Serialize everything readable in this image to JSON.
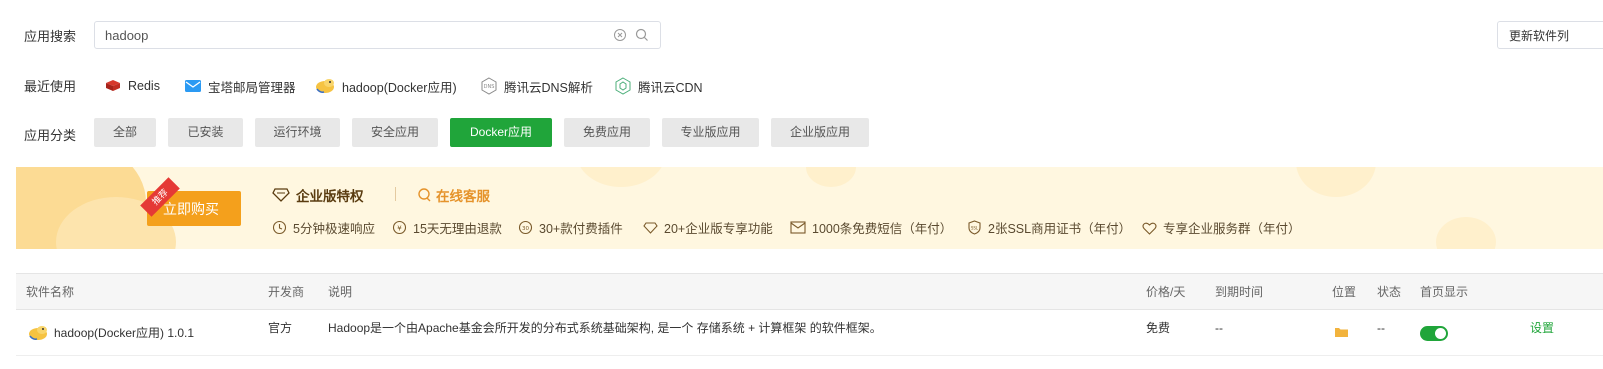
{
  "search": {
    "label": "应用搜索",
    "value": "hadoop",
    "update_button": "更新软件列"
  },
  "recent": {
    "label": "最近使用",
    "items": [
      {
        "label": "Redis",
        "icon": "redis-icon"
      },
      {
        "label": "宝塔邮局管理器",
        "icon": "mail-icon"
      },
      {
        "label": "hadoop(Docker应用)",
        "icon": "hadoop-icon"
      },
      {
        "label": "腾讯云DNS解析",
        "icon": "dns-icon"
      },
      {
        "label": "腾讯云CDN",
        "icon": "cdn-icon"
      }
    ]
  },
  "categories": {
    "label": "应用分类",
    "items": [
      "全部",
      "已安装",
      "运行环境",
      "安全应用",
      "Docker应用",
      "免费应用",
      "专业版应用",
      "企业版应用"
    ],
    "active": "Docker应用"
  },
  "banner": {
    "tag": "推荐",
    "buy_button": "立即购买",
    "title": "企业版特权",
    "service_link": "在线客服",
    "features": [
      "5分钟极速响应",
      "15天无理由退款",
      "30+款付费插件",
      "20+企业版专享功能",
      "1000条免费短信（年付）",
      "2张SSL商用证书（年付）",
      "专享企业服务群（年付）"
    ]
  },
  "table": {
    "headers": {
      "name": "软件名称",
      "developer": "开发商",
      "description": "说明",
      "price": "价格/天",
      "expire": "到期时间",
      "location": "位置",
      "status": "状态",
      "homepage": "首页显示"
    },
    "rows": [
      {
        "name": "hadoop(Docker应用) 1.0.1",
        "developer": "官方",
        "description": "Hadoop是一个由Apache基金会所开发的分布式系统基础架构, 是一个 存储系统 + 计算框架 的软件框架。",
        "price": "免费",
        "expire": "--",
        "status": "--",
        "homepage_enabled": true,
        "action": "设置"
      }
    ]
  },
  "colors": {
    "accent": "#20a53a",
    "buy": "#f4a01c",
    "service": "#e5932b"
  }
}
